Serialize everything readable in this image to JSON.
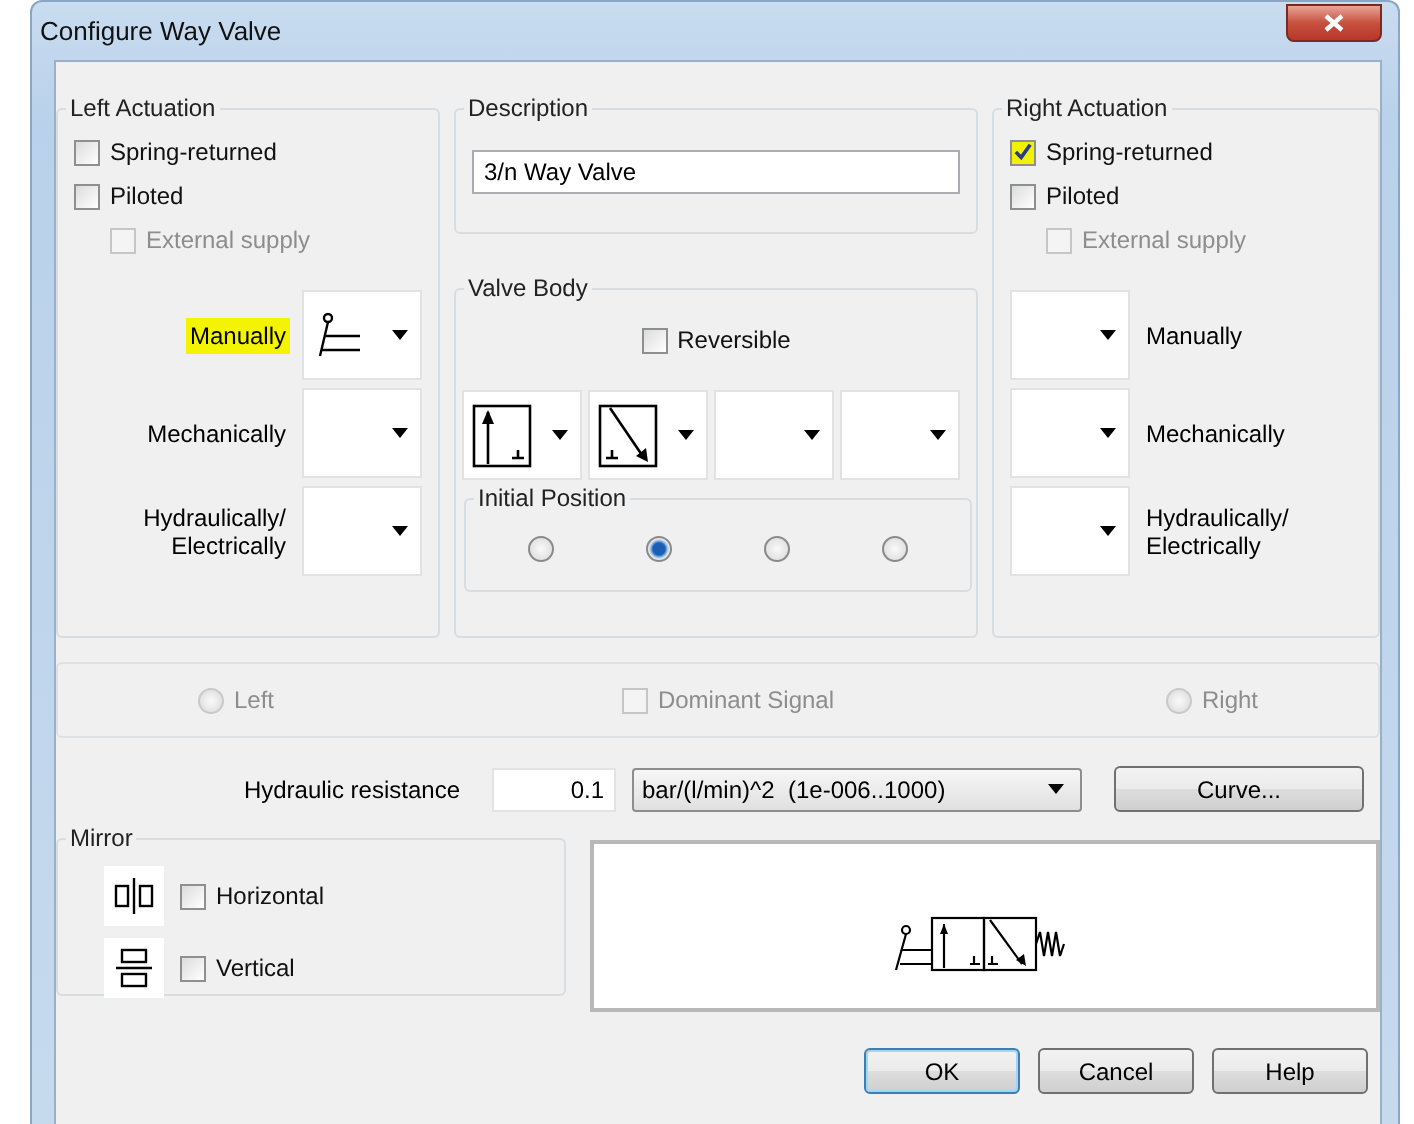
{
  "window": {
    "title": "Configure Way Valve"
  },
  "left_actuation": {
    "title": "Left Actuation",
    "options": [
      {
        "label": "Spring-returned",
        "checked": false,
        "disabled": false,
        "highlighted": false
      },
      {
        "label": "Piloted",
        "checked": false,
        "disabled": false,
        "highlighted": false,
        "children": [
          {
            "label": "External supply",
            "checked": false,
            "disabled": true,
            "highlighted": false
          }
        ]
      }
    ],
    "actuators": [
      {
        "label": "Manually",
        "highlighted": true,
        "kind": "lever"
      },
      {
        "label": "Mechanically",
        "highlighted": false,
        "kind": "blank"
      },
      {
        "label": "Hydraulically/\nElectrically",
        "highlighted": false,
        "kind": "blank"
      }
    ]
  },
  "description": {
    "title": "Description",
    "value": "3/n Way Valve"
  },
  "valve_body": {
    "title": "Valve Body",
    "reversible": {
      "label": "Reversible",
      "checked": false
    },
    "positions": [
      {
        "kind": "straight"
      },
      {
        "kind": "diagonal"
      },
      {
        "kind": "blank"
      },
      {
        "kind": "blank"
      }
    ],
    "initial_position": {
      "title": "Initial Position",
      "options": [
        {
          "selected": false
        },
        {
          "selected": true
        },
        {
          "selected": false
        },
        {
          "selected": false
        }
      ]
    }
  },
  "right_actuation": {
    "title": "Right Actuation",
    "options": [
      {
        "label": "Spring-returned",
        "checked": true,
        "disabled": false,
        "highlighted": true
      },
      {
        "label": "Piloted",
        "checked": false,
        "disabled": false,
        "highlighted": false,
        "children": [
          {
            "label": "External supply",
            "checked": false,
            "disabled": true,
            "highlighted": false
          }
        ]
      }
    ],
    "actuators": [
      {
        "label": "Manually",
        "highlighted": false,
        "kind": "blank"
      },
      {
        "label": "Mechanically",
        "highlighted": false,
        "kind": "blank"
      },
      {
        "label": "Hydraulically/\nElectrically",
        "highlighted": false,
        "kind": "blank"
      }
    ]
  },
  "dominant": {
    "left": {
      "label": "Left",
      "selected": false,
      "disabled": true
    },
    "signal": {
      "label": "Dominant Signal",
      "checked": false,
      "disabled": true
    },
    "right": {
      "label": "Right",
      "selected": false,
      "disabled": true
    }
  },
  "resistance": {
    "label": "Hydraulic resistance",
    "value": "0.1",
    "unit": "bar/(l/min)^2  (1e-006..1000)",
    "button": "Curve..."
  },
  "mirror": {
    "title": "Mirror",
    "options": [
      {
        "label": "Horizontal",
        "checked": false,
        "kind": "horizontal"
      },
      {
        "label": "Vertical",
        "checked": false,
        "kind": "vertical"
      }
    ]
  },
  "buttons": [
    {
      "label": "OK",
      "default": true
    },
    {
      "label": "Cancel",
      "default": false
    },
    {
      "label": "Help",
      "default": false
    }
  ]
}
